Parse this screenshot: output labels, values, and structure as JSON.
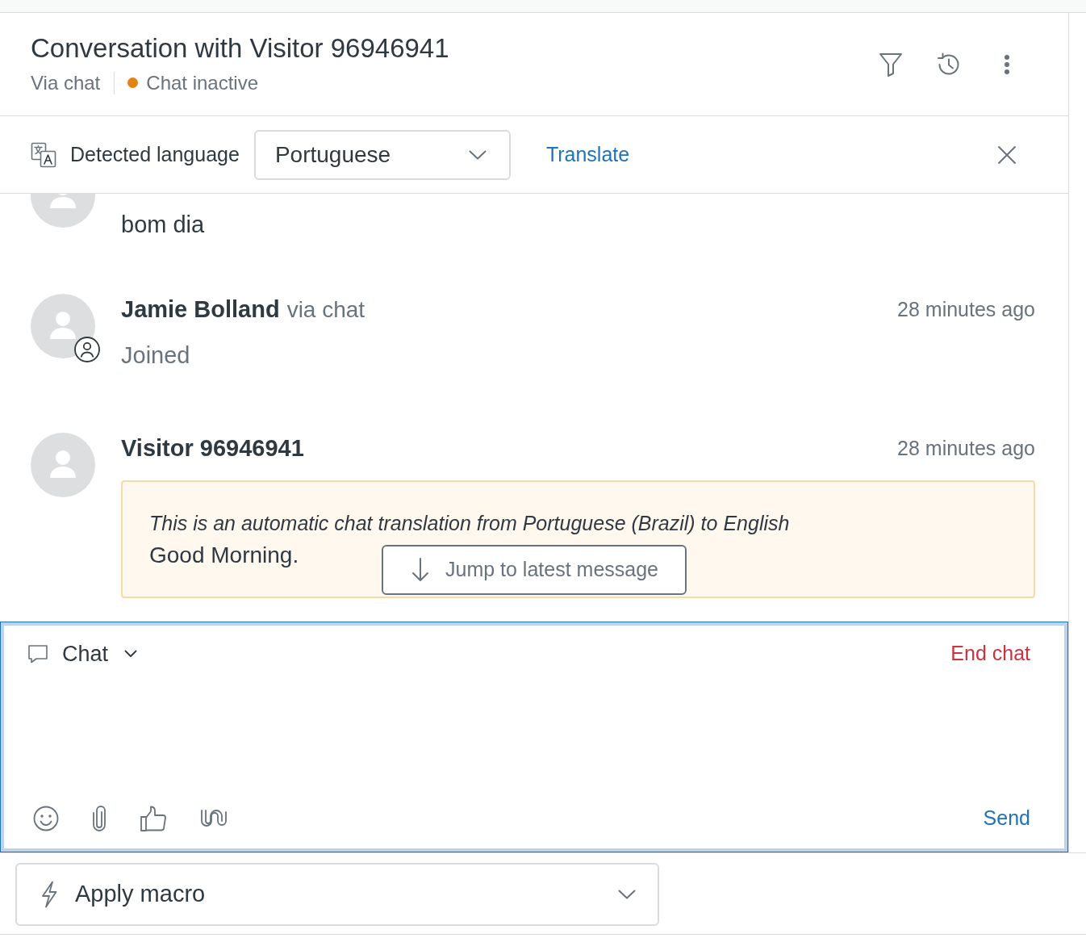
{
  "header": {
    "title": "Conversation with Visitor 96946941",
    "channel": "Via chat",
    "status": {
      "label": "Chat inactive",
      "kind": "inactive"
    }
  },
  "translation_bar": {
    "label": "Detected language",
    "language": "Portuguese",
    "action": "Translate"
  },
  "messages": [
    {
      "kind": "message",
      "text": "bom dia",
      "agent": false
    },
    {
      "kind": "system",
      "author": "Jamie Bolland",
      "channel": "via chat",
      "time": "28 minutes ago",
      "text": "Joined",
      "agent": true
    },
    {
      "kind": "translated",
      "author": "Visitor 96946941",
      "time": "28 minutes ago",
      "notice": "This is an automatic chat translation from Portuguese (Brazil) to English",
      "text": "Good Morning.",
      "agent": false
    }
  ],
  "jump_button": {
    "label": "Jump to latest message"
  },
  "composer": {
    "mode": "Chat",
    "end_action": "End chat",
    "send": "Send"
  },
  "macro": {
    "label": "Apply macro"
  }
}
